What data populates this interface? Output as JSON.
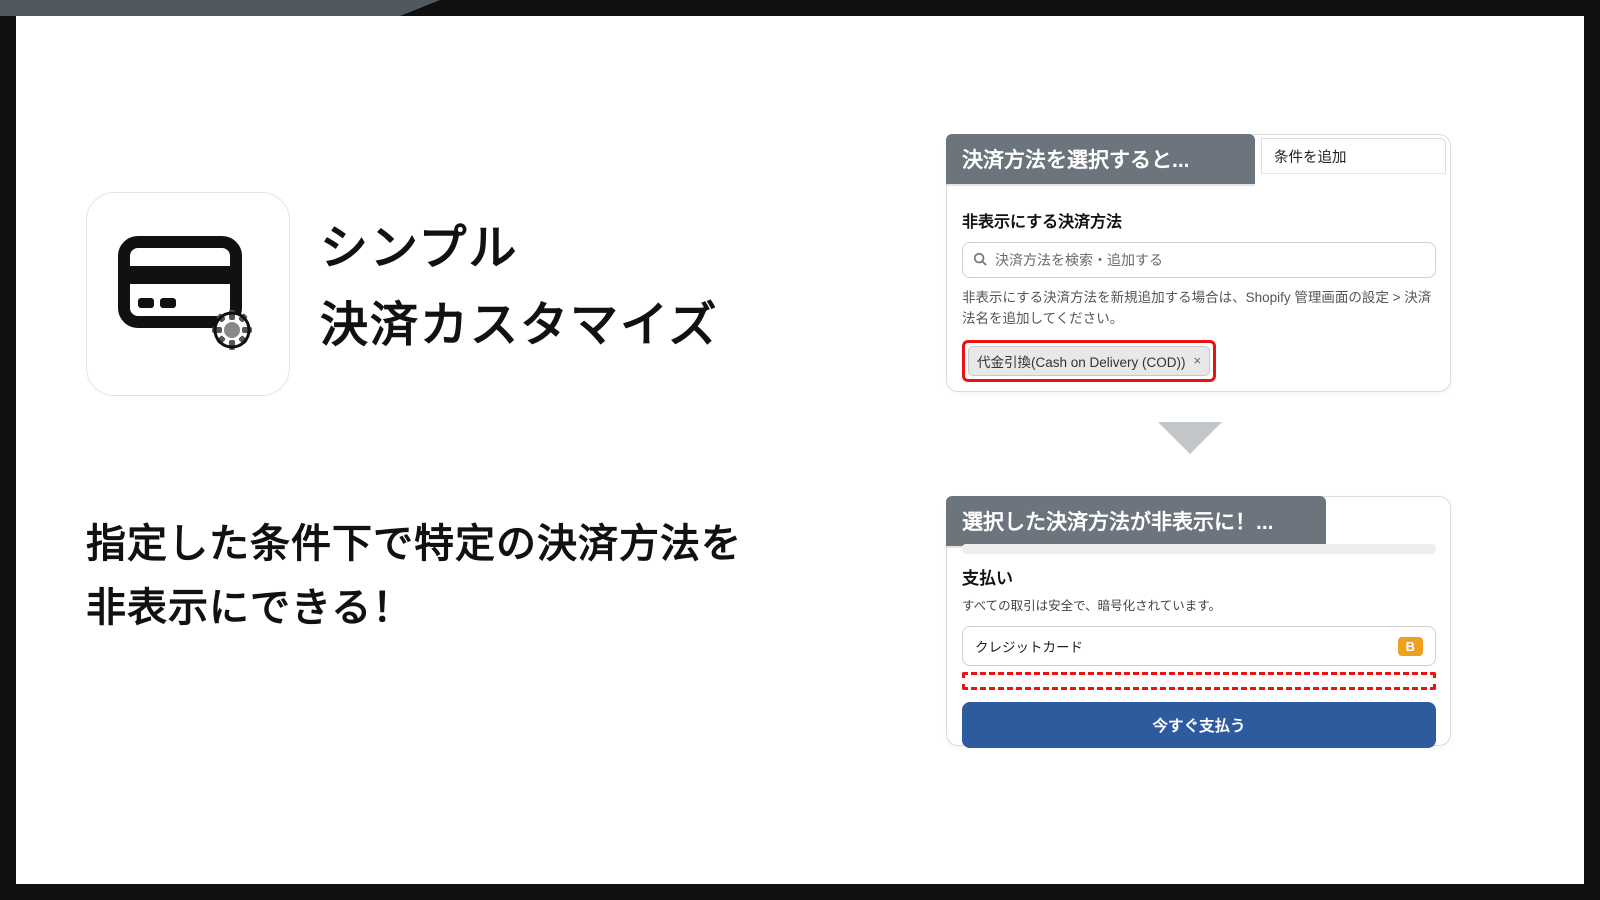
{
  "title": {
    "line1": "シンプル",
    "line2": "決済カスタマイズ"
  },
  "subhead": {
    "line1": "指定した条件下で特定の決済方法を",
    "line2": "非表示にできる！"
  },
  "panel1": {
    "banner": "決済方法を選択すると...",
    "tab": "条件を追加",
    "section_label": "非表示にする決済方法",
    "search_placeholder": "決済方法を検索・追加する",
    "help": "非表示にする決済方法を新規追加する場合は、Shopify 管理画面の設定 > 決済法名を追加してください。",
    "chip": "代金引換(Cash on Delivery (COD))"
  },
  "panel2": {
    "banner": "選択した決済方法が非表示に！...",
    "pay_heading": "支払い",
    "pay_note": "すべての取引は安全で、暗号化されています。",
    "option_label": "クレジットカード",
    "badge": "B",
    "pay_button": "今すぐ支払う"
  }
}
